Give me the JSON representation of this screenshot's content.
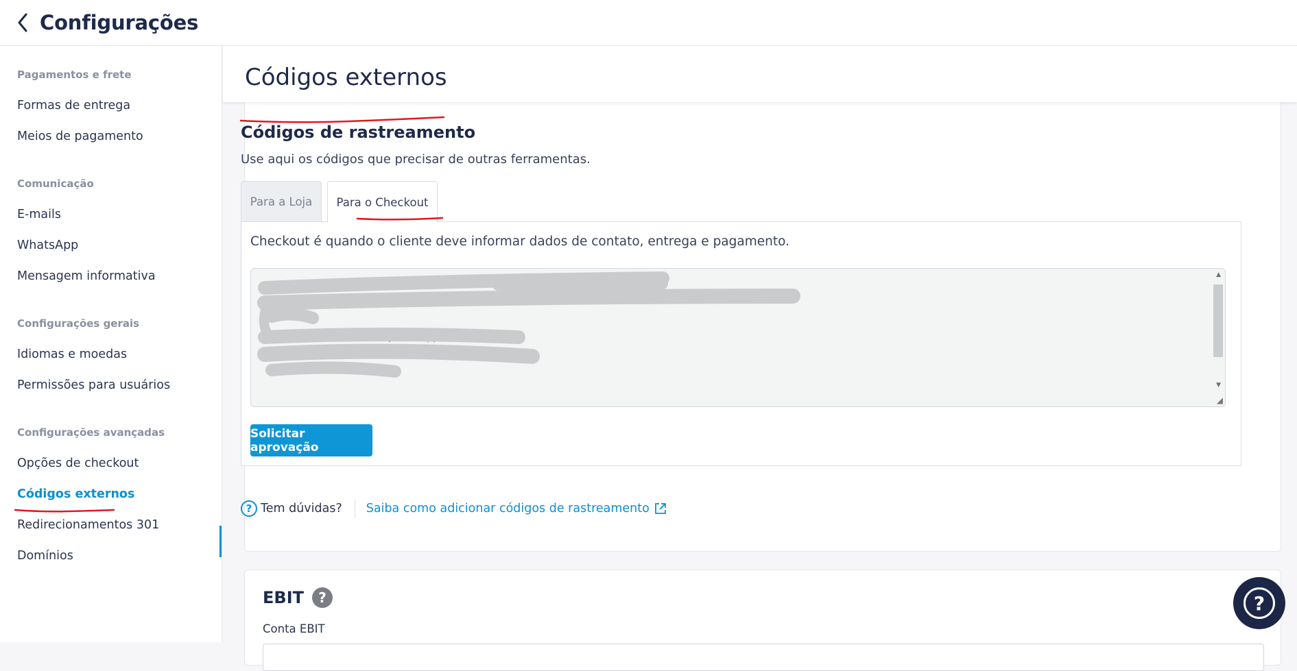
{
  "header": {
    "title": "Configurações",
    "back_icon": "chevron-left-icon"
  },
  "sidebar": {
    "sections": [
      {
        "title": "Pagamentos e frete",
        "items": [
          "Formas de entrega",
          "Meios de pagamento"
        ]
      },
      {
        "title": "Comunicação",
        "items": [
          "E-mails",
          "WhatsApp",
          "Mensagem informativa"
        ]
      },
      {
        "title": "Configurações gerais",
        "items": [
          "Idiomas e moedas",
          "Permissões para usuários"
        ]
      },
      {
        "title": "Configurações avançadas",
        "items": [
          "Opções de checkout",
          "Códigos externos",
          "Redirecionamentos 301",
          "Domínios"
        ]
      }
    ],
    "active_item": "Códigos externos"
  },
  "page": {
    "title": "Códigos externos"
  },
  "tracking": {
    "title": "Códigos de rastreamento",
    "description": "Use aqui os códigos que precisar de outras ferramentas.",
    "tabs": [
      {
        "label": "Para a Loja",
        "active": false
      },
      {
        "label": "Para o Checkout",
        "active": true
      }
    ],
    "panel_description": "Checkout é quando o cliente deve informar dados de contato, entrega e pagamento.",
    "code_fragments": [
      "painel nuvem -->",
      "p>",
      "windowAdJasyel[ ]||"
    ],
    "submit_button": "Solicitar aprovação",
    "help_question": "Tem dúvidas?",
    "help_link": "Saiba como adicionar códigos de rastreamento"
  },
  "ebit": {
    "title": "EBIT",
    "account_label": "Conta EBIT"
  },
  "colors": {
    "accent": "#0e8fd1",
    "button": "#0f96d7",
    "annotation": "#e0191e",
    "fab": "#1c2646"
  }
}
